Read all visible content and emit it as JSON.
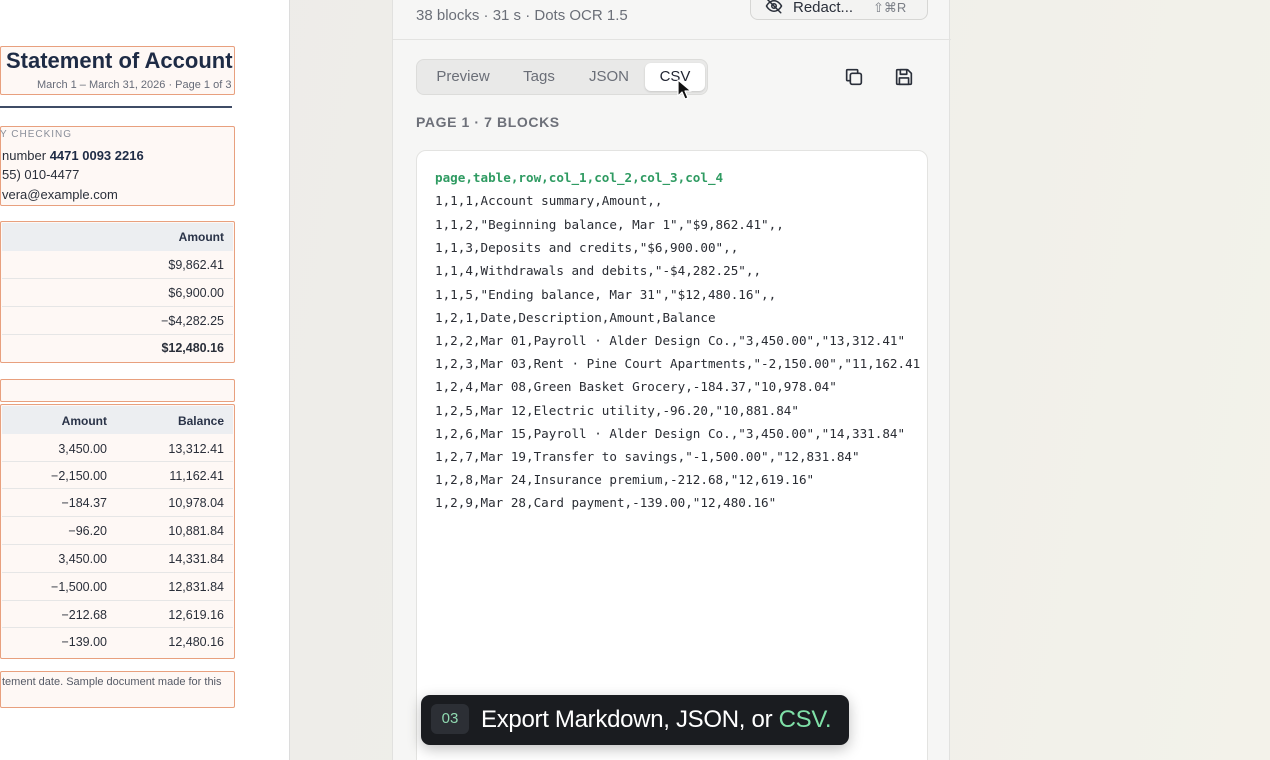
{
  "document": {
    "title": "Statement of Account",
    "subtitle": "March 1 – March 31, 2026 · Page 1 of 3",
    "account_label": "Y CHECKING",
    "account_number_prefix": "number",
    "account_number": "4471 0093 2216",
    "phone": "55) 010-4477",
    "email": "vera@example.com",
    "summary": {
      "header": "Amount",
      "values": [
        "$9,862.41",
        "$6,900.00",
        "−$4,282.25",
        "$12,480.16"
      ]
    },
    "transactions": {
      "headers": [
        "Amount",
        "Balance"
      ],
      "rows": [
        [
          "3,450.00",
          "13,312.41"
        ],
        [
          "−2,150.00",
          "11,162.41"
        ],
        [
          "−184.37",
          "10,978.04"
        ],
        [
          "−96.20",
          "10,881.84"
        ],
        [
          "3,450.00",
          "14,331.84"
        ],
        [
          "−1,500.00",
          "12,831.84"
        ],
        [
          "−212.68",
          "12,619.16"
        ],
        [
          "−139.00",
          "12,480.16"
        ]
      ]
    },
    "footnote": "tement date. Sample document made for this"
  },
  "panel": {
    "stats": "38 blocks · 31 s · Dots OCR 1.5",
    "redact": {
      "label": "Redact...",
      "shortcut": "⇧⌘R"
    },
    "tabs": [
      "Preview",
      "Tags",
      "JSON",
      "CSV"
    ],
    "active_tab": "CSV",
    "page_label": "PAGE 1 · 7 BLOCKS",
    "csv_header": "page,table,row,col_1,col_2,col_3,col_4",
    "csv_lines": [
      "1,1,1,Account summary,Amount,,",
      "1,1,2,\"Beginning balance, Mar 1\",\"$9,862.41\",,",
      "1,1,3,Deposits and credits,\"$6,900.00\",,",
      "1,1,4,Withdrawals and debits,\"-$4,282.25\",,",
      "1,1,5,\"Ending balance, Mar 31\",\"$12,480.16\",,",
      "1,2,1,Date,Description,Amount,Balance",
      "1,2,2,Mar 01,Payroll · Alder Design Co.,\"3,450.00\",\"13,312.41\"",
      "1,2,3,Mar 03,Rent · Pine Court Apartments,\"-2,150.00\",\"11,162.41",
      "1,2,4,Mar 08,Green Basket Grocery,-184.37,\"10,978.04\"",
      "1,2,5,Mar 12,Electric utility,-96.20,\"10,881.84\"",
      "1,2,6,Mar 15,Payroll · Alder Design Co.,\"3,450.00\",\"14,331.84\"",
      "1,2,7,Mar 19,Transfer to savings,\"-1,500.00\",\"12,831.84\"",
      "1,2,8,Mar 24,Insurance premium,-212.68,\"12,619.16\"",
      "1,2,9,Mar 28,Card payment,-139.00,\"12,480.16\""
    ]
  },
  "caption": {
    "step": "03",
    "text": "Export Markdown, JSON, or ",
    "accent": "CSV."
  },
  "colors": {
    "ocr_box": "#e8a07e",
    "csv_header": "#2f9b62",
    "caption_accent": "#7fe0a7"
  },
  "icons": [
    "eye-off-icon",
    "copy-icon",
    "save-icon",
    "cursor-arrow-icon"
  ]
}
